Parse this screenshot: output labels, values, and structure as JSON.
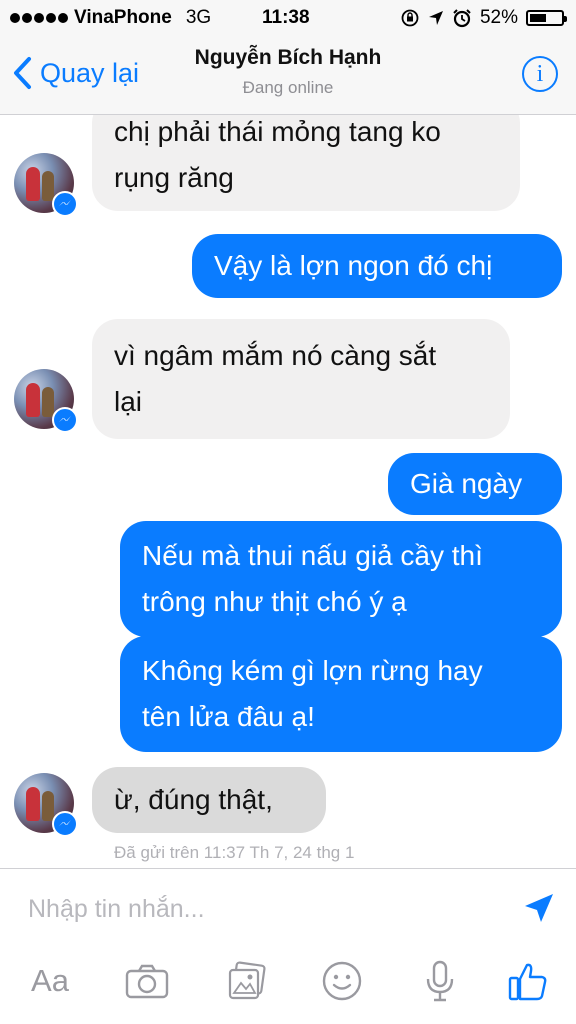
{
  "status_bar": {
    "carrier": "VinaPhone",
    "network": "3G",
    "time": "11:38",
    "battery_percent": "52%",
    "battery_level": 0.52,
    "icons": [
      "rotation-lock-icon",
      "location-arrow-icon",
      "alarm-icon",
      "battery-icon"
    ]
  },
  "nav": {
    "back_label": "Quay lại",
    "title": "Nguyễn Bích Hạnh",
    "subtitle": "Đang online",
    "info_label": "i"
  },
  "messages": [
    {
      "direction": "in",
      "lines": [
        "chị phải thái mỏng tang ko",
        "rụng răng"
      ]
    },
    {
      "direction": "out",
      "lines": [
        "Vậy là lợn ngon đó chị"
      ]
    },
    {
      "direction": "in",
      "lines": [
        "vì ngâm mắm nó càng sắt",
        "lại"
      ]
    },
    {
      "direction": "out",
      "lines": [
        "Già ngày"
      ]
    },
    {
      "direction": "out",
      "lines": [
        "Nếu mà thui nấu giả cầy thì",
        "trông như thịt chó ý ạ"
      ]
    },
    {
      "direction": "out",
      "lines": [
        "Không kém gì lợn rừng hay",
        "tên lửa đâu ạ!"
      ]
    },
    {
      "direction": "in",
      "lines": [
        "ừ, đúng thật,"
      ]
    }
  ],
  "delivered_text": "Đã gửi trên 11:37 Th 7, 24 thg 1",
  "composer": {
    "placeholder": "Nhập tin nhắn...",
    "toolbar_aa": "Aa"
  },
  "colors": {
    "accent": "#0a7cff",
    "incoming_bubble": "#f1f0f0",
    "selected_bubble": "#dadada",
    "outgoing_bubble": "#0a7cff"
  }
}
